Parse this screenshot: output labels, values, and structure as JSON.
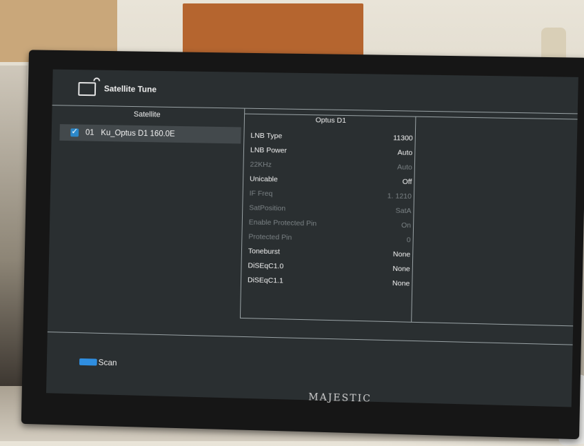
{
  "header": {
    "title": "Satellite Tune"
  },
  "satellite_panel": {
    "header": "Satellite",
    "items": [
      {
        "number": "01",
        "name": "Ku_Optus D1 160.0E",
        "checked": true
      }
    ]
  },
  "details": {
    "title": "Optus D1",
    "rows": [
      {
        "label": "LNB Type",
        "value": "11300",
        "enabled": true
      },
      {
        "label": "LNB Power",
        "value": "Auto",
        "enabled": true
      },
      {
        "label": "22KHz",
        "value": "Auto",
        "enabled": false
      },
      {
        "label": "Unicable",
        "value": "Off",
        "enabled": true
      },
      {
        "label": "IF Freq",
        "value": "1. 1210",
        "enabled": false
      },
      {
        "label": "SatPosition",
        "value": "SatA",
        "enabled": false
      },
      {
        "label": "Enable Protected Pin",
        "value": "On",
        "enabled": false
      },
      {
        "label": "Protected Pin",
        "value": "0",
        "enabled": false
      },
      {
        "label": "Toneburst",
        "value": "None",
        "enabled": true
      },
      {
        "label": "DiSEqC1.0",
        "value": "None",
        "enabled": true
      },
      {
        "label": "DiSEqC1.1",
        "value": "None",
        "enabled": true
      }
    ]
  },
  "footer": {
    "scan_label": "Scan",
    "scan_key_color": "#2f8ee0"
  },
  "device": {
    "brand": "MAJESTIC"
  },
  "colors": {
    "screen_bg": "#2a2f31",
    "selected_row_bg": "#43494c",
    "checkbox": "#2c88c9"
  }
}
